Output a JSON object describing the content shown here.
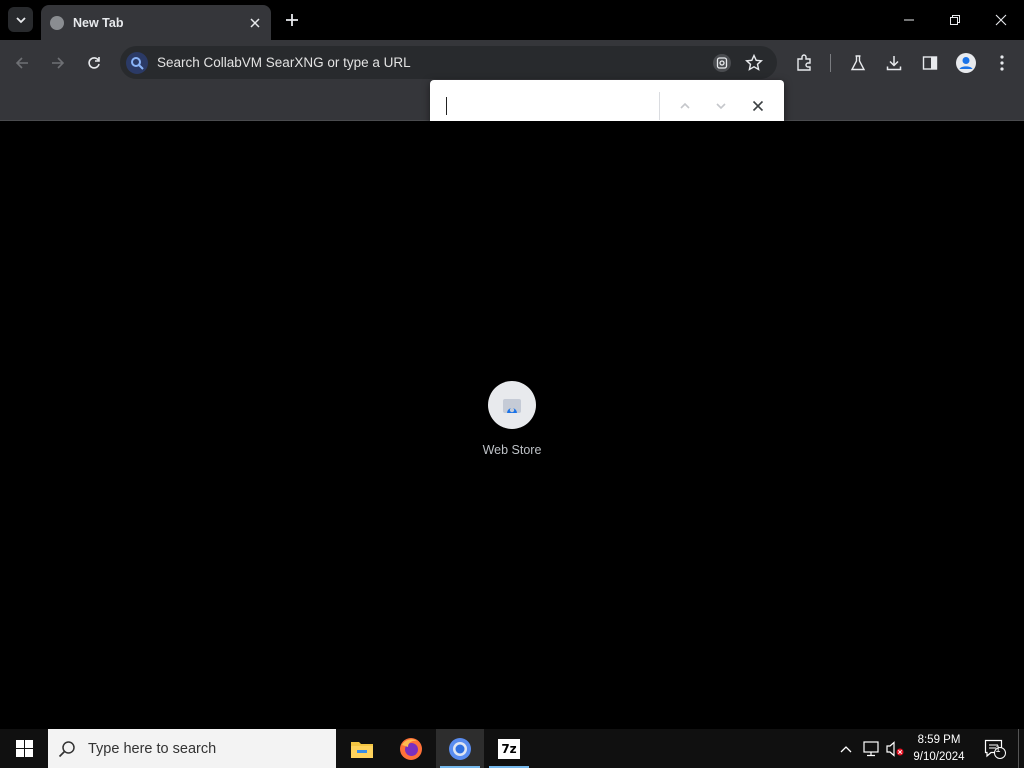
{
  "browser": {
    "tab": {
      "title": "New Tab"
    },
    "omnibox": {
      "placeholder": "Search CollabVM SearXNG or type a URL"
    },
    "find_bar": {
      "value": ""
    }
  },
  "new_tab_page": {
    "shortcuts": [
      {
        "label": "Web Store"
      }
    ]
  },
  "taskbar": {
    "search_placeholder": "Type here to search",
    "apps": [
      "file-explorer",
      "firefox",
      "chrome",
      "7-zip"
    ],
    "apps_labels": {
      "sevenzip": "7z"
    },
    "clock": {
      "time": "8:59 PM",
      "date": "9/10/2024"
    },
    "notification_count": "1"
  },
  "colors": {
    "accent": "#76b9ed",
    "toolbar": "#35363a",
    "tabstrip": "#000000"
  }
}
